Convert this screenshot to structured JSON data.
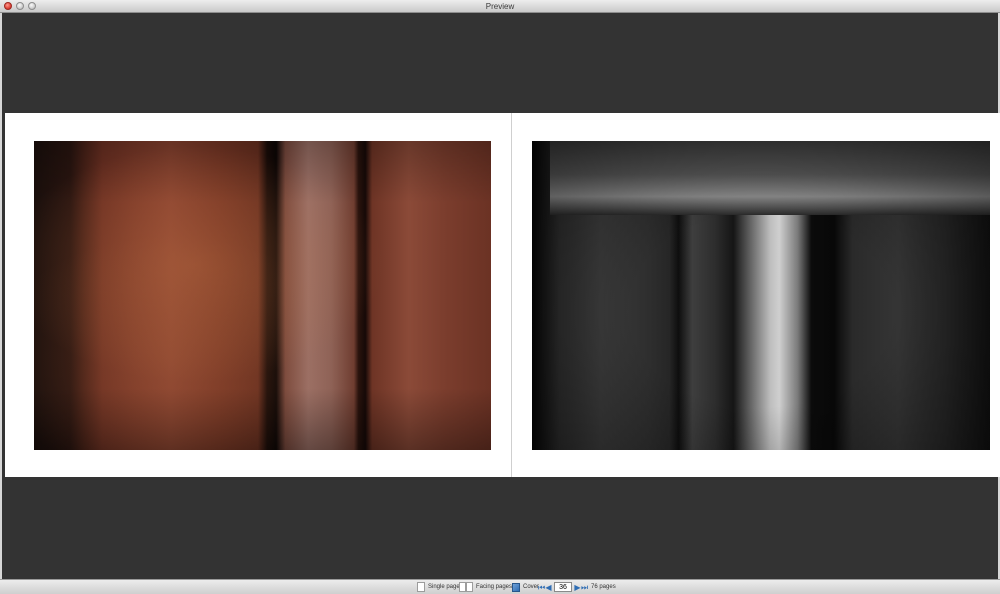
{
  "window": {
    "title": "Preview"
  },
  "spread": {
    "left_photo": "textured-red-rock-photo",
    "right_photo": "monochrome-weathered-wood-photo"
  },
  "toolbar": {
    "single_page_label": "Single page",
    "facing_pages_label": "Facing pages",
    "cover_label": "Cover",
    "current_page": "36",
    "page_count_label": "76 pages"
  },
  "colors": {
    "background": "#333333",
    "page": "#ffffff",
    "nav_accent": "#2f6db4"
  }
}
